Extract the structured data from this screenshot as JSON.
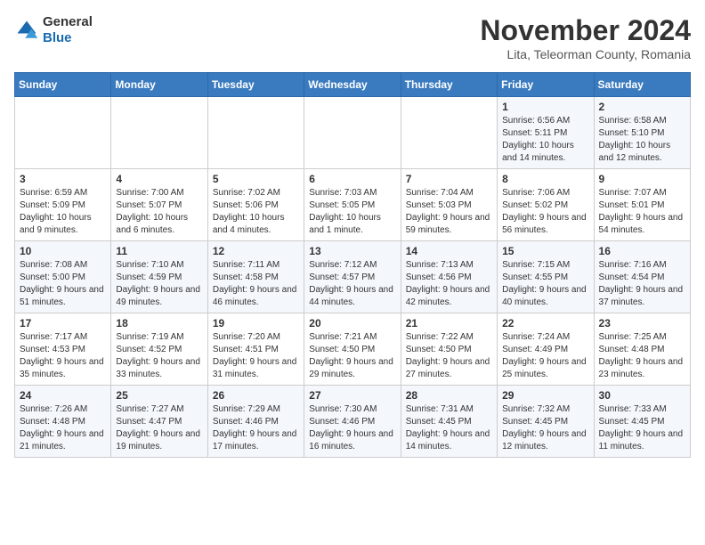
{
  "logo": {
    "general": "General",
    "blue": "Blue"
  },
  "header": {
    "month": "November 2024",
    "location": "Lita, Teleorman County, Romania"
  },
  "weekdays": [
    "Sunday",
    "Monday",
    "Tuesday",
    "Wednesday",
    "Thursday",
    "Friday",
    "Saturday"
  ],
  "weeks": [
    [
      {
        "day": "",
        "info": ""
      },
      {
        "day": "",
        "info": ""
      },
      {
        "day": "",
        "info": ""
      },
      {
        "day": "",
        "info": ""
      },
      {
        "day": "",
        "info": ""
      },
      {
        "day": "1",
        "info": "Sunrise: 6:56 AM\nSunset: 5:11 PM\nDaylight: 10 hours and 14 minutes."
      },
      {
        "day": "2",
        "info": "Sunrise: 6:58 AM\nSunset: 5:10 PM\nDaylight: 10 hours and 12 minutes."
      }
    ],
    [
      {
        "day": "3",
        "info": "Sunrise: 6:59 AM\nSunset: 5:09 PM\nDaylight: 10 hours and 9 minutes."
      },
      {
        "day": "4",
        "info": "Sunrise: 7:00 AM\nSunset: 5:07 PM\nDaylight: 10 hours and 6 minutes."
      },
      {
        "day": "5",
        "info": "Sunrise: 7:02 AM\nSunset: 5:06 PM\nDaylight: 10 hours and 4 minutes."
      },
      {
        "day": "6",
        "info": "Sunrise: 7:03 AM\nSunset: 5:05 PM\nDaylight: 10 hours and 1 minute."
      },
      {
        "day": "7",
        "info": "Sunrise: 7:04 AM\nSunset: 5:03 PM\nDaylight: 9 hours and 59 minutes."
      },
      {
        "day": "8",
        "info": "Sunrise: 7:06 AM\nSunset: 5:02 PM\nDaylight: 9 hours and 56 minutes."
      },
      {
        "day": "9",
        "info": "Sunrise: 7:07 AM\nSunset: 5:01 PM\nDaylight: 9 hours and 54 minutes."
      }
    ],
    [
      {
        "day": "10",
        "info": "Sunrise: 7:08 AM\nSunset: 5:00 PM\nDaylight: 9 hours and 51 minutes."
      },
      {
        "day": "11",
        "info": "Sunrise: 7:10 AM\nSunset: 4:59 PM\nDaylight: 9 hours and 49 minutes."
      },
      {
        "day": "12",
        "info": "Sunrise: 7:11 AM\nSunset: 4:58 PM\nDaylight: 9 hours and 46 minutes."
      },
      {
        "day": "13",
        "info": "Sunrise: 7:12 AM\nSunset: 4:57 PM\nDaylight: 9 hours and 44 minutes."
      },
      {
        "day": "14",
        "info": "Sunrise: 7:13 AM\nSunset: 4:56 PM\nDaylight: 9 hours and 42 minutes."
      },
      {
        "day": "15",
        "info": "Sunrise: 7:15 AM\nSunset: 4:55 PM\nDaylight: 9 hours and 40 minutes."
      },
      {
        "day": "16",
        "info": "Sunrise: 7:16 AM\nSunset: 4:54 PM\nDaylight: 9 hours and 37 minutes."
      }
    ],
    [
      {
        "day": "17",
        "info": "Sunrise: 7:17 AM\nSunset: 4:53 PM\nDaylight: 9 hours and 35 minutes."
      },
      {
        "day": "18",
        "info": "Sunrise: 7:19 AM\nSunset: 4:52 PM\nDaylight: 9 hours and 33 minutes."
      },
      {
        "day": "19",
        "info": "Sunrise: 7:20 AM\nSunset: 4:51 PM\nDaylight: 9 hours and 31 minutes."
      },
      {
        "day": "20",
        "info": "Sunrise: 7:21 AM\nSunset: 4:50 PM\nDaylight: 9 hours and 29 minutes."
      },
      {
        "day": "21",
        "info": "Sunrise: 7:22 AM\nSunset: 4:50 PM\nDaylight: 9 hours and 27 minutes."
      },
      {
        "day": "22",
        "info": "Sunrise: 7:24 AM\nSunset: 4:49 PM\nDaylight: 9 hours and 25 minutes."
      },
      {
        "day": "23",
        "info": "Sunrise: 7:25 AM\nSunset: 4:48 PM\nDaylight: 9 hours and 23 minutes."
      }
    ],
    [
      {
        "day": "24",
        "info": "Sunrise: 7:26 AM\nSunset: 4:48 PM\nDaylight: 9 hours and 21 minutes."
      },
      {
        "day": "25",
        "info": "Sunrise: 7:27 AM\nSunset: 4:47 PM\nDaylight: 9 hours and 19 minutes."
      },
      {
        "day": "26",
        "info": "Sunrise: 7:29 AM\nSunset: 4:46 PM\nDaylight: 9 hours and 17 minutes."
      },
      {
        "day": "27",
        "info": "Sunrise: 7:30 AM\nSunset: 4:46 PM\nDaylight: 9 hours and 16 minutes."
      },
      {
        "day": "28",
        "info": "Sunrise: 7:31 AM\nSunset: 4:45 PM\nDaylight: 9 hours and 14 minutes."
      },
      {
        "day": "29",
        "info": "Sunrise: 7:32 AM\nSunset: 4:45 PM\nDaylight: 9 hours and 12 minutes."
      },
      {
        "day": "30",
        "info": "Sunrise: 7:33 AM\nSunset: 4:45 PM\nDaylight: 9 hours and 11 minutes."
      }
    ]
  ]
}
